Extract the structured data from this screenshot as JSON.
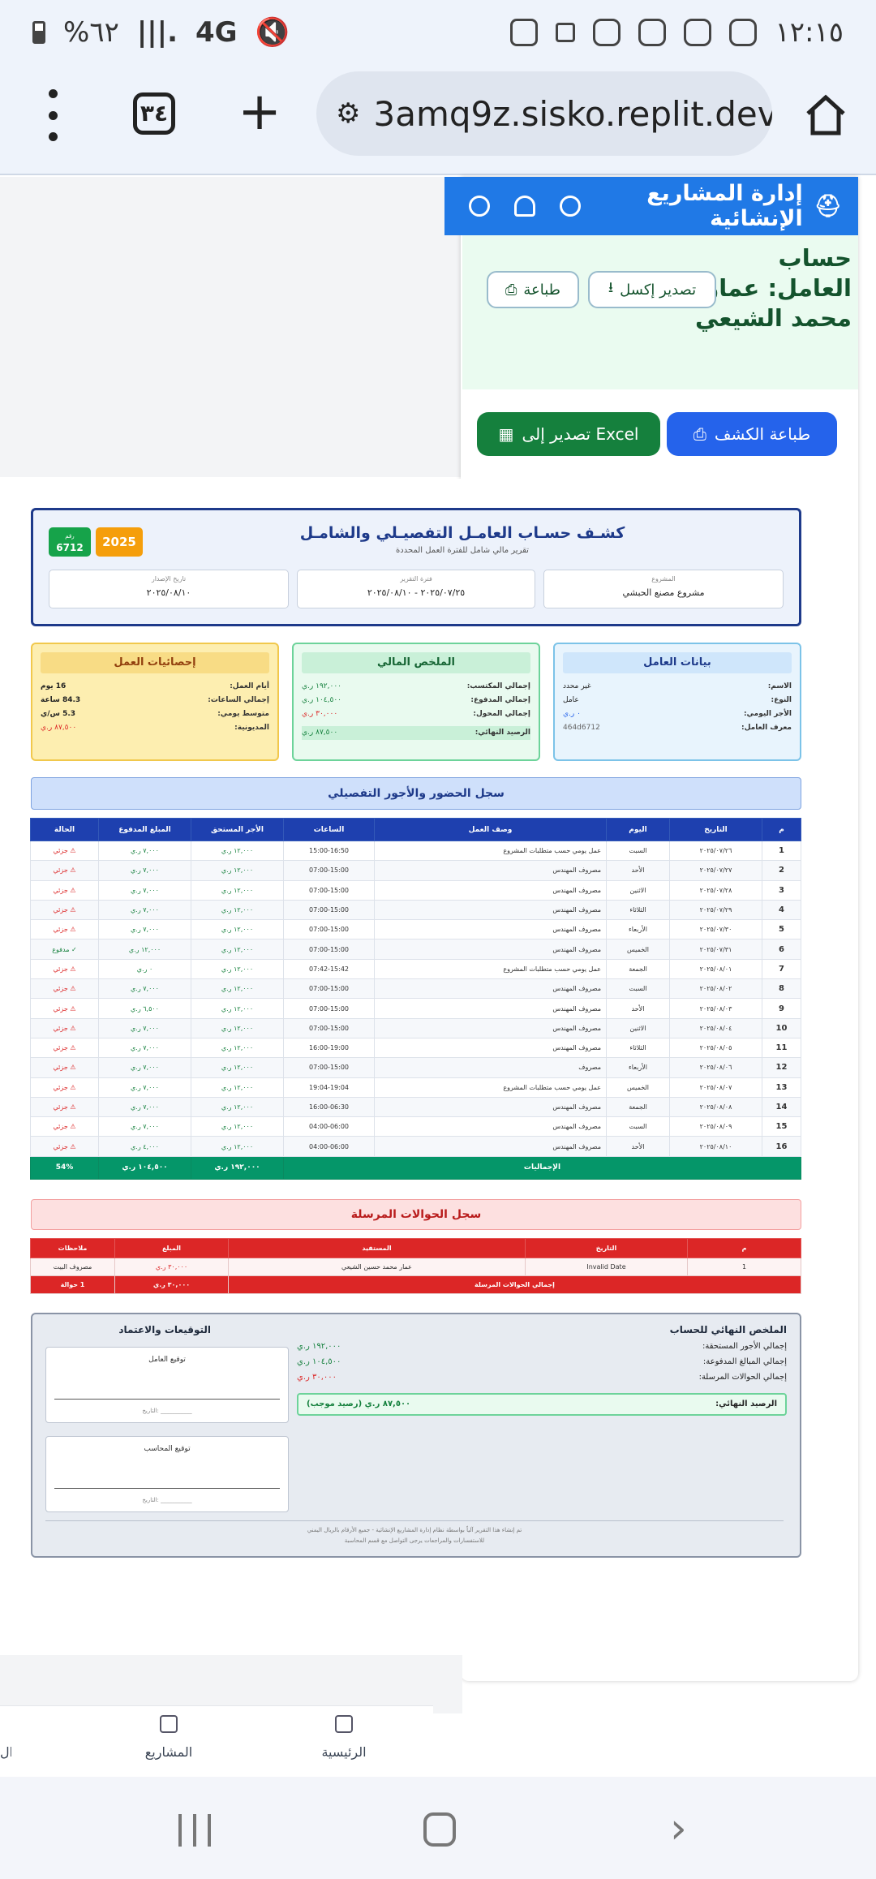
{
  "status_bar": {
    "time": "١٢:١٥",
    "battery": "%٦٢",
    "network": "4G"
  },
  "browser": {
    "url": "3amq9z.sisko.replit.dev",
    "tab_count": "٣٤"
  },
  "app_header": {
    "title": "إدارة المشاريع الإنشائية"
  },
  "page_header": {
    "worker_title": "حساب العامل: عمار محمد الشيعي",
    "export_excel": "تصدير إكسل",
    "print": "طباعة",
    "print_statement": "طباعة الكشف",
    "export_to_excel": "تصدير إلى Excel"
  },
  "report": {
    "title": "كشـف حسـاب العامـل التفصيـلي والشامـل",
    "subtitle": "تقرير مالي شامل للفترة العمل المحددة",
    "year_badge": "2025",
    "number_label": "رقم",
    "number": "6712",
    "project_label": "المشروع",
    "project": "مشروع مصنع الحبشي",
    "period_label": "فترة التقرير",
    "period": "٢٠٢٥/٠٧/٢٥ - ٢٠٢٥/٠٨/١٠",
    "issue_label": "تاريخ الإصدار",
    "issue_date": "٢٠٢٥/٠٨/١٠"
  },
  "worker_info": {
    "header": "بيانات العامل",
    "rows": [
      {
        "k": "الاسم:",
        "v": "غير محدد"
      },
      {
        "k": "النوع:",
        "v": "عامل"
      },
      {
        "k": "الأجر اليومي:",
        "v": "٠ ر.ي"
      },
      {
        "k": "معرف العامل:",
        "v": "464d6712"
      }
    ]
  },
  "financial_summary": {
    "header": "الملخص المالي",
    "rows": [
      {
        "k": "إجمالي المكتسب:",
        "v": "١٩٢,٠٠٠ ر.ي"
      },
      {
        "k": "إجمالي المدفوع:",
        "v": "١٠٤,٥٠٠ ر.ي"
      },
      {
        "k": "إجمالي المحول:",
        "v": "٣٠,٠٠٠ ر.ي"
      },
      {
        "k": "الرصيد النهائي:",
        "v": "٨٧,٥٠٠ ر.ي"
      }
    ]
  },
  "work_stats": {
    "header": "إحصائيات العمل",
    "rows": [
      {
        "k": "أيام العمل:",
        "v": "16 يوم"
      },
      {
        "k": "إجمالي الساعات:",
        "v": "84.3 ساعة"
      },
      {
        "k": "متوسط يومي:",
        "v": "5.3 س/ي"
      },
      {
        "k": "المديونية:",
        "v": "٨٧,٥٠٠ ر.ي"
      }
    ]
  },
  "attendance": {
    "section_title": "سجل الحضور والأجور التفصيلي",
    "headers": [
      "م",
      "التاريخ",
      "اليوم",
      "وصف العمل",
      "الساعات",
      "الأجر المستحق",
      "المبلغ المدفوع",
      "الحالة"
    ],
    "rows": [
      [
        "1",
        "٢٠٢٥/٠٧/٢٦",
        "السبت",
        "عمل يومي حسب متطلبات المشروع",
        "15:00-16:50",
        "١٢,٠٠٠ ر.ي",
        "٧,٠٠٠ ر.ي",
        "⚠ جزئي"
      ],
      [
        "2",
        "٢٠٢٥/٠٧/٢٧",
        "الأحد",
        "مصروف المهندس",
        "07:00-15:00",
        "١٢,٠٠٠ ر.ي",
        "٧,٠٠٠ ر.ي",
        "⚠ جزئي"
      ],
      [
        "3",
        "٢٠٢٥/٠٧/٢٨",
        "الاثنين",
        "مصروف المهندس",
        "07:00-15:00",
        "١٢,٠٠٠ ر.ي",
        "٧,٠٠٠ ر.ي",
        "⚠ جزئي"
      ],
      [
        "4",
        "٢٠٢٥/٠٧/٢٩",
        "الثلاثاء",
        "مصروف المهندس",
        "07:00-15:00",
        "١٢,٠٠٠ ر.ي",
        "٧,٠٠٠ ر.ي",
        "⚠ جزئي"
      ],
      [
        "5",
        "٢٠٢٥/٠٧/٣٠",
        "الأربعاء",
        "مصروف المهندس",
        "07:00-15:00",
        "١٢,٠٠٠ ر.ي",
        "٧,٠٠٠ ر.ي",
        "⚠ جزئي"
      ],
      [
        "6",
        "٢٠٢٥/٠٧/٣١",
        "الخميس",
        "مصروف المهندس",
        "07:00-15:00",
        "١٢,٠٠٠ ر.ي",
        "١٢,٠٠٠ ر.ي",
        "✓ مدفوع"
      ],
      [
        "7",
        "٢٠٢٥/٠٨/٠١",
        "الجمعة",
        "عمل يومي حسب متطلبات المشروع",
        "07:42-15:42",
        "١٢,٠٠٠ ر.ي",
        "٠ ر.ي",
        "⚠ جزئي"
      ],
      [
        "8",
        "٢٠٢٥/٠٨/٠٢",
        "السبت",
        "مصروف المهندس",
        "07:00-15:00",
        "١٢,٠٠٠ ر.ي",
        "٧,٠٠٠ ر.ي",
        "⚠ جزئي"
      ],
      [
        "9",
        "٢٠٢٥/٠٨/٠٣",
        "الأحد",
        "مصروف المهندس",
        "07:00-15:00",
        "١٢,٠٠٠ ر.ي",
        "٦,٥٠٠ ر.ي",
        "⚠ جزئي"
      ],
      [
        "10",
        "٢٠٢٥/٠٨/٠٤",
        "الاثنين",
        "مصروف المهندس",
        "07:00-15:00",
        "١٢,٠٠٠ ر.ي",
        "٧,٠٠٠ ر.ي",
        "⚠ جزئي"
      ],
      [
        "11",
        "٢٠٢٥/٠٨/٠٥",
        "الثلاثاء",
        "مصروف المهندس",
        "16:00-19:00",
        "١٢,٠٠٠ ر.ي",
        "٧,٠٠٠ ر.ي",
        "⚠ جزئي"
      ],
      [
        "12",
        "٢٠٢٥/٠٨/٠٦",
        "الأربعاء",
        "مصروف",
        "07:00-15:00",
        "١٢,٠٠٠ ر.ي",
        "٧,٠٠٠ ر.ي",
        "⚠ جزئي"
      ],
      [
        "13",
        "٢٠٢٥/٠٨/٠٧",
        "الخميس",
        "عمل يومي حسب متطلبات المشروع",
        "19:04-19:04",
        "١٢,٠٠٠ ر.ي",
        "٧,٠٠٠ ر.ي",
        "⚠ جزئي"
      ],
      [
        "14",
        "٢٠٢٥/٠٨/٠٨",
        "الجمعة",
        "مصروف المهندس",
        "16:00-06:30",
        "١٢,٠٠٠ ر.ي",
        "٧,٠٠٠ ر.ي",
        "⚠ جزئي"
      ],
      [
        "15",
        "٢٠٢٥/٠٨/٠٩",
        "السبت",
        "مصروف المهندس",
        "04:00-06:00",
        "١٢,٠٠٠ ر.ي",
        "٧,٠٠٠ ر.ي",
        "⚠ جزئي"
      ],
      [
        "16",
        "٢٠٢٥/٠٨/١٠",
        "الأحد",
        "مصروف المهندس",
        "04:00-06:00",
        "١٢,٠٠٠ ر.ي",
        "٤,٠٠٠ ر.ي",
        "⚠ جزئي"
      ]
    ],
    "totals": {
      "label": "الإجماليات",
      "earned": "١٩٢,٠٠٠ ر.ي",
      "paid": "١٠٤,٥٠٠ ر.ي",
      "pct": "54%"
    }
  },
  "transfers": {
    "section_title": "سجل الحوالات المرسلة",
    "headers": [
      "م",
      "التاريخ",
      "المستفيد",
      "المبلغ",
      "ملاحظات"
    ],
    "rows": [
      [
        "1",
        "Invalid Date",
        "عمار محمد حسين الشيعي",
        "٣٠,٠٠٠ ر.ي",
        "مصروف البيت"
      ]
    ],
    "totals": {
      "label": "إجمالي الحوالات المرسلة",
      "amount": "٣٠,٠٠٠ ر.ي",
      "count": "1 حوالة"
    }
  },
  "final_summary": {
    "title": "الملخص النهائي للحساب",
    "rows": [
      {
        "k": "إجمالي الأجور المستحقة:",
        "v": "١٩٢,٠٠٠ ر.ي"
      },
      {
        "k": "إجمالي المبالغ المدفوعة:",
        "v": "١٠٤,٥٠٠ ر.ي"
      },
      {
        "k": "إجمالي الحوالات المرسلة:",
        "v": "٣٠,٠٠٠ ر.ي"
      }
    ],
    "final_label": "الرصيد النهائي:",
    "final_value": "٨٧,٥٠٠ ر.ي (رصيد موجب)",
    "signatures_title": "التوقيعات والاعتماد",
    "worker_sig": "توقيع العامل",
    "accountant_sig": "توقيع المحاسب",
    "date_label": "التاريخ: ___________",
    "footer1": "تم إنشاء هذا التقرير آلياً بواسطة نظام إدارة المشاريع الإنشائية - جميع الأرقام بالريال اليمني",
    "footer2": "للاستفسارات والمراجعات يرجى التواصل مع قسم المحاسبة"
  },
  "bottom_nav": {
    "home": "الرئيسية",
    "projects": "المشاريع",
    "partial": "ال"
  },
  "colors": {
    "primary": "#2079e6",
    "green": "#15803d",
    "red": "#dc2626",
    "navy": "#1e3a8a"
  }
}
